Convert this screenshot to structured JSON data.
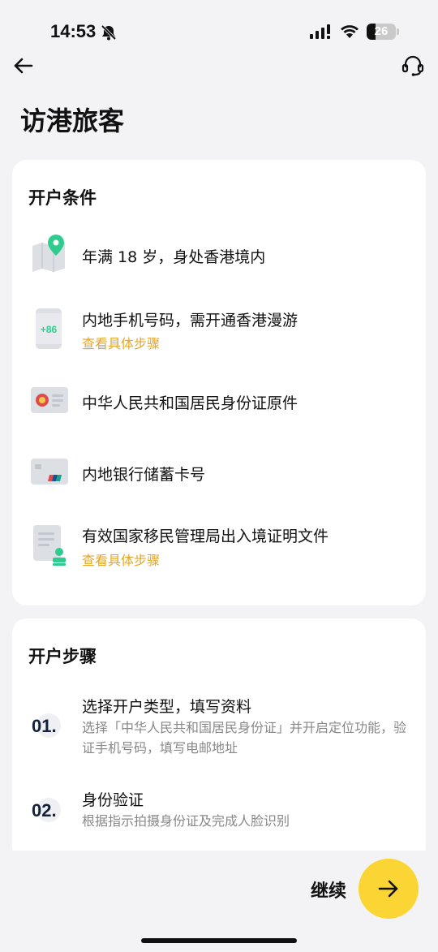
{
  "status_bar": {
    "time": "14:53",
    "battery": "26",
    "icons": [
      "bell-slash-icon",
      "signal-icon",
      "wifi-icon",
      "battery-icon"
    ]
  },
  "nav": {
    "back_icon": "back-arrow-icon",
    "support_icon": "headset-icon"
  },
  "page": {
    "title": "访港旅客"
  },
  "requirements": {
    "heading": "开户条件",
    "items": [
      {
        "icon": "location-map-icon",
        "text": "年满 18 岁，身处香港境内",
        "link": ""
      },
      {
        "icon": "phone-icon",
        "icon_label": "+86",
        "text": "内地手机号码，需开通香港漫游",
        "link": "查看具体步骤"
      },
      {
        "icon": "id-card-icon",
        "text": "中华人民共和国居民身份证原件",
        "link": ""
      },
      {
        "icon": "bank-card-icon",
        "text": "内地银行储蓄卡号",
        "link": ""
      },
      {
        "icon": "document-person-icon",
        "text": "有效国家移民管理局出入境证明文件",
        "link": "查看具体步骤"
      }
    ]
  },
  "steps": {
    "heading": "开户步骤",
    "items": [
      {
        "number": "01.",
        "title": "选择开户类型，填写资料",
        "desc": "选择「中华人民共和国居民身份证」并开启定位功能，验证手机号码，填写电邮地址"
      },
      {
        "number": "02.",
        "title": "身份验证",
        "desc": "根据指示拍摄身份证及完成人脸识别"
      }
    ]
  },
  "footer": {
    "continue_label": "继续",
    "continue_icon": "arrow-right-icon"
  },
  "colors": {
    "accent_yellow": "#fbd534",
    "link_orange": "#e5a526",
    "icon_green": "#2ecc8f",
    "background": "#f3f3f5"
  }
}
